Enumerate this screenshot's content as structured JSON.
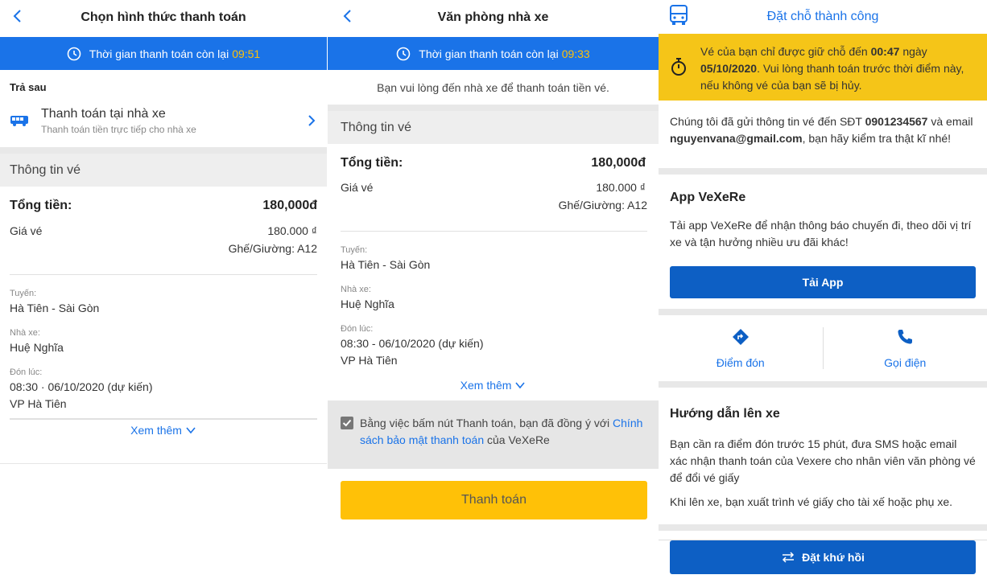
{
  "panel1": {
    "title": "Chọn hình thức thanh toán",
    "timer_label": "Thời gian thanh toán còn lại",
    "timer_value": "09:51",
    "pay_later": "Trả sau",
    "option_title": "Thanh toán tại nhà xe",
    "option_sub": "Thanh toán tiền trực tiếp cho nhà xe",
    "ticket_info": "Thông tin vé",
    "total_label": "Tổng tiền:",
    "total_value": "180,000đ",
    "price_label": "Giá vé",
    "price_value": "180.000 ₫",
    "seat": "Ghế/Giường: A12",
    "route_label": "Tuyến:",
    "route_value": "Hà Tiên - Sài Gòn",
    "operator_label": "Nhà xe:",
    "operator_value": "Huệ Nghĩa",
    "pickup_label": "Đón lúc:",
    "pickup_time": "08:30 · 06/10/2020 (dự kiến)",
    "pickup_place": "VP Hà Tiên",
    "see_more": "Xem thêm"
  },
  "panel2": {
    "title": "Văn phòng nhà xe",
    "timer_label": "Thời gian thanh toán còn lại",
    "timer_value": "09:33",
    "notice": "Bạn vui lòng đến nhà xe để thanh toán tiền vé.",
    "ticket_info": "Thông tin vé",
    "total_label": "Tổng tiền:",
    "total_value": "180,000đ",
    "price_label": "Giá vé",
    "price_value": "180.000 ₫",
    "seat": "Ghế/Giường: A12",
    "route_label": "Tuyến:",
    "route_value": "Hà Tiên - Sài Gòn",
    "operator_label": "Nhà xe:",
    "operator_value": "Huệ Nghĩa",
    "pickup_label": "Đón lúc:",
    "pickup_time": "08:30 - 06/10/2020 (dự kiến)",
    "pickup_place": "VP Hà Tiên",
    "see_more": "Xem thêm",
    "agree_text": "Bằng việc bấm nút Thanh toán, bạn đã đồng ý với",
    "agree_link": "Chính sách bảo mật thanh toán",
    "agree_suffix": "của VeXeRe",
    "pay_button": "Thanh toán"
  },
  "panel3": {
    "title": "Đặt chỗ thành công",
    "hold_pre": "Vé của bạn chỉ được giữ chỗ đến",
    "hold_time": "00:47",
    "hold_mid": "ngày",
    "hold_date": "05/10/2020",
    "hold_post": ". Vui lòng thanh toán trước thời điểm này, nếu không vé của bạn sẽ bị hủy.",
    "sent_pre": "Chúng tôi đã gửi thông tin vé đến SĐT",
    "phone": "0901234567",
    "sent_mid": "và email",
    "email": "nguyenvana@gmail.com",
    "sent_post": ", bạn hãy kiểm tra thật kĩ nhé!",
    "app_title": "App VeXeRe",
    "app_desc": "Tải app VeXeRe để nhận thông báo chuyến đi, theo dõi vị trí xe và tận hưởng nhiều ưu đãi khác!",
    "download_button": "Tải App",
    "pickup_point": "Điểm đón",
    "call": "Gọi điện",
    "guide_title": "Hướng dẫn lên xe",
    "guide_p1": "Bạn cần ra điểm đón trước 15 phút, đưa SMS hoặc email xác nhận thanh toán của Vexere cho nhân viên văn phòng vé để đổi vé giấy",
    "guide_p2": "Khi lên xe, bạn xuất trình vé giấy cho tài xế hoặc phụ xe.",
    "return_button": "Đặt khứ hồi"
  },
  "colors": {
    "primary": "#1a73e8",
    "accent": "#ffc107",
    "button_blue": "#0d5fc4"
  }
}
